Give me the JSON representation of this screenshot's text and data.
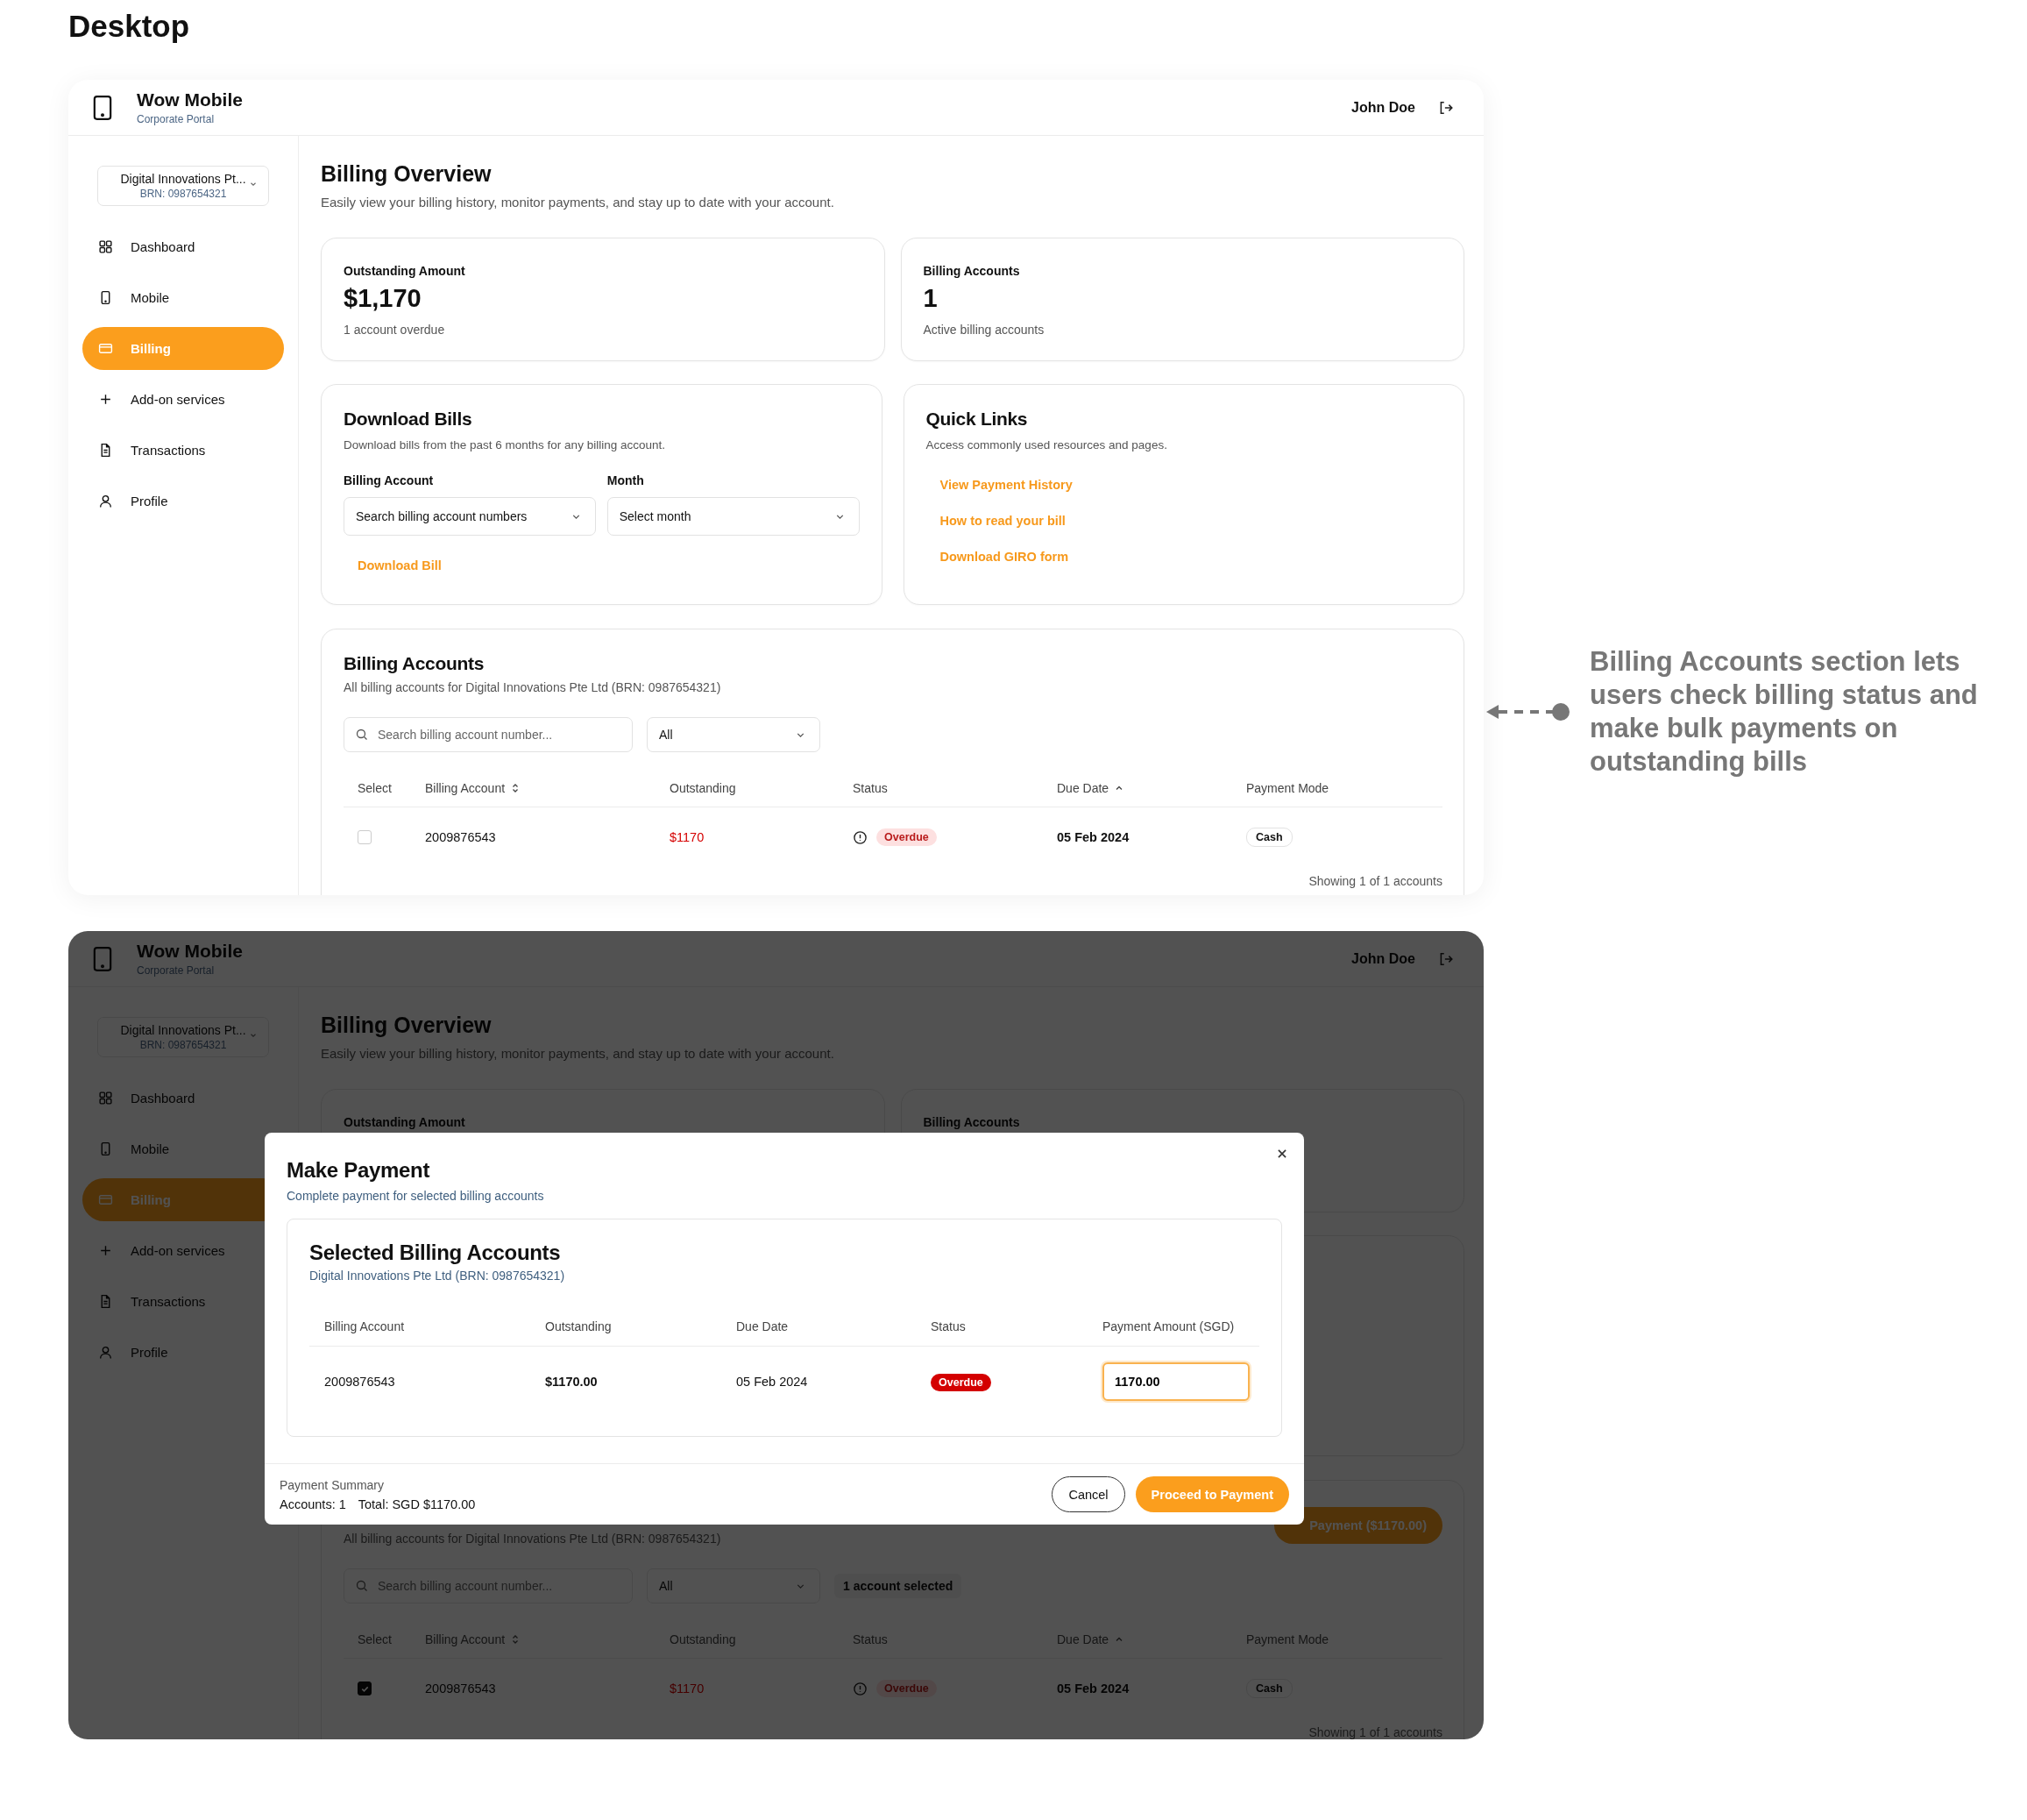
{
  "page_title": "Desktop",
  "desktop_screen": {
    "header": {
      "brand": "Wow Mobile",
      "subtitle": "Corporate Portal",
      "user": "John Doe"
    },
    "sidebar": {
      "org_name": "Digital Innovations Pt...",
      "org_brn": "BRN: 0987654321",
      "items": [
        {
          "label": "Dashboard",
          "selected": false
        },
        {
          "label": "Mobile",
          "selected": false
        },
        {
          "label": "Billing",
          "selected": true
        },
        {
          "label": "Add-on services",
          "selected": false
        },
        {
          "label": "Transactions",
          "selected": false
        },
        {
          "label": "Profile",
          "selected": false
        }
      ]
    },
    "page": {
      "title": "Billing Overview",
      "subtitle": "Easily view your billing history, monitor payments, and stay up to date with your account."
    },
    "summary_cards": [
      {
        "label": "Outstanding Amount",
        "value": "$1,170",
        "note": "1 account overdue"
      },
      {
        "label": "Billing Accounts",
        "value": "1",
        "note": "Active billing accounts"
      }
    ],
    "download_bills": {
      "title": "Download Bills",
      "description": "Download bills from the past 6 months for any billing account.",
      "fields": [
        {
          "label": "Billing Account",
          "placeholder": "Search billing account numbers"
        },
        {
          "label": "Month",
          "placeholder": "Select month"
        }
      ],
      "action": "Download Bill"
    },
    "quick_links": {
      "title": "Quick Links",
      "description": "Access commonly used resources and pages.",
      "links": [
        "View Payment History",
        "How to read your bill",
        "Download GIRO form"
      ]
    },
    "billing_accounts": {
      "title": "Billing Accounts",
      "subtitle": "All billing accounts for Digital Innovations Pte Ltd (BRN: 0987654321)",
      "search_placeholder": "Search billing account number...",
      "filter_value": "All",
      "columns": [
        {
          "label": "Select",
          "sortable": false,
          "ascending": false
        },
        {
          "label": "Billing Account",
          "sortable": true,
          "ascending": false
        },
        {
          "label": "Outstanding",
          "sortable": false,
          "ascending": false
        },
        {
          "label": "Status",
          "sortable": false,
          "ascending": false
        },
        {
          "label": "Due Date",
          "sortable": true,
          "ascending": true
        },
        {
          "label": "Payment Mode",
          "sortable": false,
          "ascending": false
        }
      ],
      "rows": [
        {
          "selected": false,
          "account": "2009876543",
          "outstanding": "$1170",
          "status": "Overdue",
          "overdue": true,
          "due_date": "05 Feb 2024",
          "payment_mode": "Cash"
        }
      ],
      "footer": "Showing 1 of 1 accounts"
    }
  },
  "modal_screen": {
    "header": {
      "brand": "Wow Mobile",
      "subtitle": "Corporate Portal",
      "user": "John Doe"
    },
    "sidebar": {
      "org_name": "Digital Innovations Pt...",
      "org_brn": "BRN: 0987654321",
      "items": [
        {
          "label": "Dashboard",
          "selected": false
        },
        {
          "label": "Mobile",
          "selected": false
        },
        {
          "label": "Billing",
          "selected": true
        },
        {
          "label": "Add-on services",
          "selected": false
        },
        {
          "label": "Transactions",
          "selected": false
        },
        {
          "label": "Profile",
          "selected": false
        }
      ]
    },
    "page": {
      "title": "Billing Overview",
      "subtitle": "Easily view your billing history, monitor payments, and stay up to date with your account."
    },
    "summary_cards": [
      {
        "label": "Outstanding Amount"
      },
      {
        "label": "Billing Accounts"
      }
    ],
    "billing_accounts": {
      "subtitle": "All billing accounts for Digital Innovations Pte Ltd (BRN: 0987654321)",
      "action_button": "Payment ($1170.00)",
      "search_placeholder": "Search billing account number...",
      "filter_value": "All",
      "selection_count": "1 account selected",
      "columns": [
        {
          "label": "Select",
          "sortable": false,
          "ascending": false
        },
        {
          "label": "Billing Account",
          "sortable": true,
          "ascending": false
        },
        {
          "label": "Outstanding",
          "sortable": false,
          "ascending": false
        },
        {
          "label": "Status",
          "sortable": false,
          "ascending": false
        },
        {
          "label": "Due Date",
          "sortable": true,
          "ascending": true
        },
        {
          "label": "Payment Mode",
          "sortable": false,
          "ascending": false
        }
      ],
      "rows": [
        {
          "selected": true,
          "account": "2009876543",
          "outstanding": "$1170",
          "status": "Overdue",
          "overdue": true,
          "due_date": "05 Feb 2024",
          "payment_mode": "Cash"
        }
      ],
      "footer": "Showing 1 of 1 accounts"
    },
    "modal": {
      "title": "Make Payment",
      "subtitle": "Complete payment for selected billing accounts",
      "section_title": "Selected Billing Accounts",
      "section_subtitle": "Digital Innovations Pte Ltd (BRN: 0987654321)",
      "columns": [
        "Billing Account",
        "Outstanding",
        "Due Date",
        "Status",
        "Payment Amount (SGD)"
      ],
      "rows": [
        {
          "account": "2009876543",
          "outstanding": "$1170.00",
          "due_date": "05 Feb 2024",
          "status": "Overdue",
          "overdue": true,
          "payment_amount": "1170.00"
        }
      ],
      "summary_label": "Payment Summary",
      "accounts": "Accounts: 1",
      "total": "Total: SGD $1170.00",
      "buttons": [
        {
          "label": "Cancel",
          "kind": "secondary"
        },
        {
          "label": "Proceed to Payment",
          "kind": "primary"
        }
      ]
    }
  },
  "annotation": {
    "text": "Billing Accounts section lets users check billing status and make bulk payments on outstanding bills"
  }
}
